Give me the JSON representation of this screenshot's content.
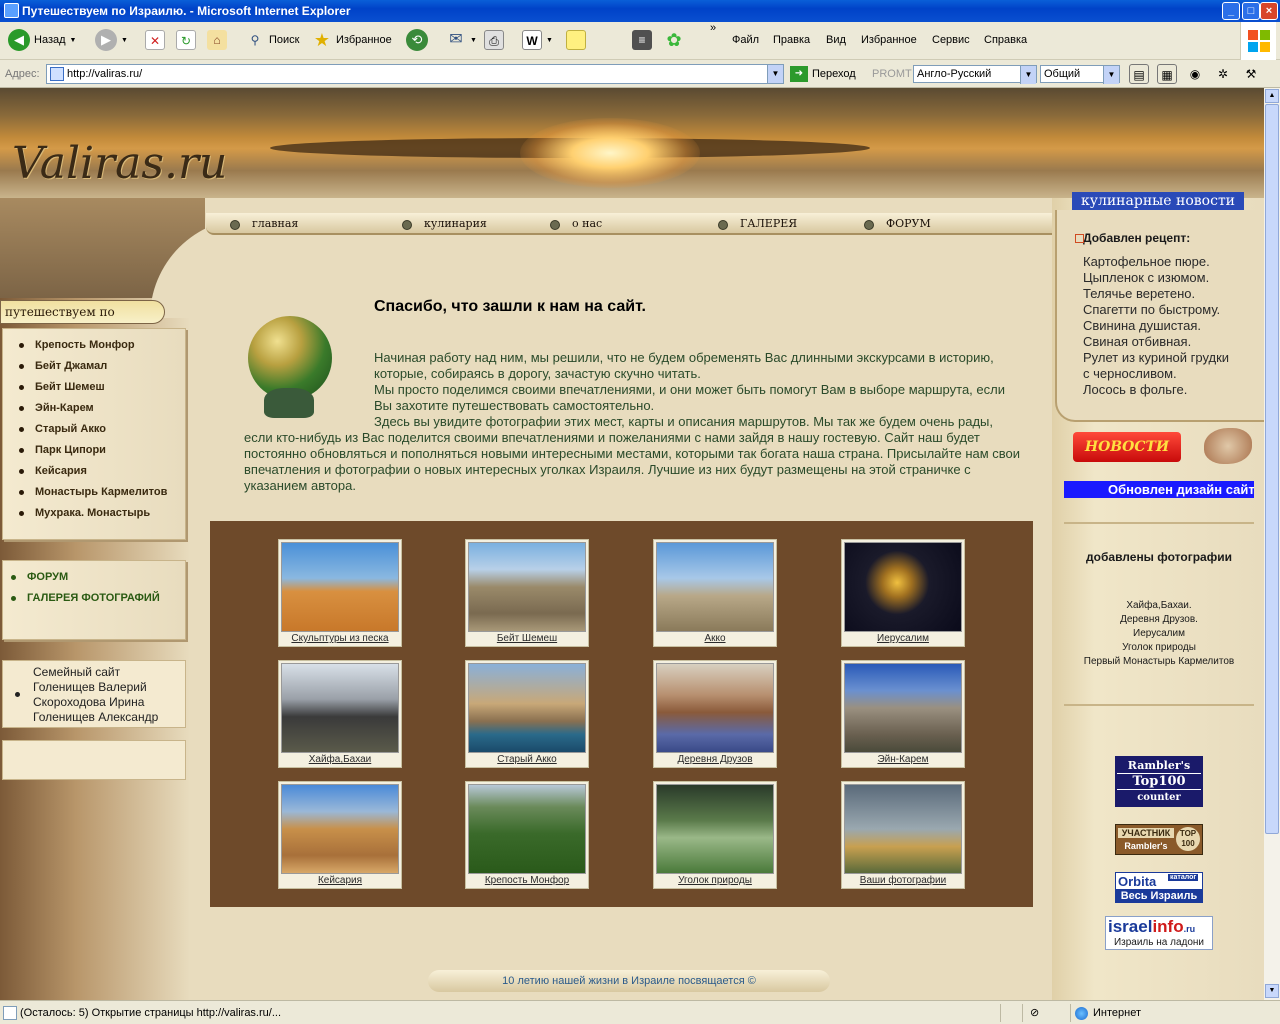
{
  "window": {
    "title": "Путешествуем по Израилю. - Microsoft Internet Explorer"
  },
  "toolbar": {
    "back_label": "Назад",
    "search_label": "Поиск",
    "favorites_label": "Избранное",
    "menu": [
      "Файл",
      "Правка",
      "Вид",
      "Избранное",
      "Сервис",
      "Справка"
    ]
  },
  "addressbar": {
    "label": "Адрес:",
    "url": "http://valiras.ru/",
    "go_label": "Переход",
    "promt_label": "PROMT",
    "translate_value": "Англо-Русский",
    "topic_value": "Общий"
  },
  "site": {
    "logo": "Valiras.ru",
    "nav": [
      "главная",
      "кулинария",
      "о нас",
      "ГАЛЕРЕЯ",
      "ФОРУМ"
    ],
    "left_title": "путешествуем по Израилю",
    "places": [
      "Крепость Монфор",
      "Бейт Джамал",
      "Бейт Шемеш",
      "Эйн-Карем",
      "Старый Акко",
      "Парк Ципори",
      "Кейсария",
      "Монастырь Кармелитов",
      "Мухрака. Монастырь"
    ],
    "links": [
      "ФОРУМ",
      "ГАЛЕРЕЯ ФОТОГРАФИЙ"
    ],
    "family": [
      "Семейный сайт",
      "Голенищев Валерий",
      "Скороходова Ирина",
      "Голенищев Александр"
    ],
    "welcome": "Спасибо, что зашли к нам на сайт.",
    "intro": [
      "Начиная работу над ним, мы решили, что не будем обременять Вас длинными экскурсами в историю, которые, собираясь в дорогу, зачастую скучно читать.",
      "Мы просто поделимся своими впечатлениями, и они может быть помогут Вам в выборе маршрута, если Вы захотите путешествовать самостоятельно.",
      "Здесь вы увидите фотографии этих мест, карты и описания маршрутов. Мы так же будем очень рады, если кто-нибудь из Вас поделится своими впечатлениями и пожеланиями с нами зайдя в нашу гостевую. Сайт наш будет постоянно обновляться и пополняться новыми интересными местами, которыми так богата наша страна. Присылайте нам свои впечатления и фотографии о новых интересных уголках Израиля. Лучшие из них будут размещены на этой страничке с указанием автора."
    ],
    "gallery": [
      "Скульптуры из песка",
      "Бейт Шемеш",
      "Акко",
      "Иерусалим",
      "Хайфа,Бахаи",
      "Старый Акко",
      "Деревня Друзов",
      "Эйн-Карем",
      "Кейсария",
      "Крепость Монфор",
      "Уголок природы",
      "Ваши фотографии"
    ],
    "culinary_title": "кулинарные новости",
    "recipe_added": "Добавлен рецепт:",
    "recipes": [
      "Картофельное пюре.",
      "Цыпленок с изюмом.",
      "Телячье веретено.",
      "Спагетти по быстрому.",
      "Свинина душистая.",
      "Свиная отбивная.",
      "Рулет из куриной грудки",
      "с черносливом.",
      "Лосось в фольге."
    ],
    "news_label": "НОВОСТИ",
    "ticker": "Обновлен дизайн сайта",
    "photos_title": "добавлены фотографии",
    "photos": [
      "Хайфа,Бахаи.",
      "Деревня Друзов.",
      "Иерусалим",
      "Уголок природы",
      "Первый Монастырь Кармелитов"
    ],
    "badges": {
      "rambler_top": [
        "Rambler's",
        "Top100",
        "counter"
      ],
      "rambler_member": [
        "УЧАСТНИК",
        "Rambler's",
        "TOP",
        "100"
      ],
      "orbita": [
        "Orbita",
        "каталог",
        "Весь Израиль"
      ],
      "israelinfo": [
        "israel",
        "info",
        ".ru",
        "Израиль на ладони"
      ]
    },
    "footer": "10 летию нашей жизни в Израиле посвящается ©"
  },
  "statusbar": {
    "text": "(Осталось: 5) Открытие страницы http://valiras.ru/...",
    "zone": "Интернет"
  },
  "colors": {
    "title_blue": "#0a5fd8",
    "gallery_bg": "#6e4a2a",
    "intro_text": "#2a4a2a",
    "news_red": "#c80a0a",
    "ticker_blue": "#1a1aff"
  }
}
